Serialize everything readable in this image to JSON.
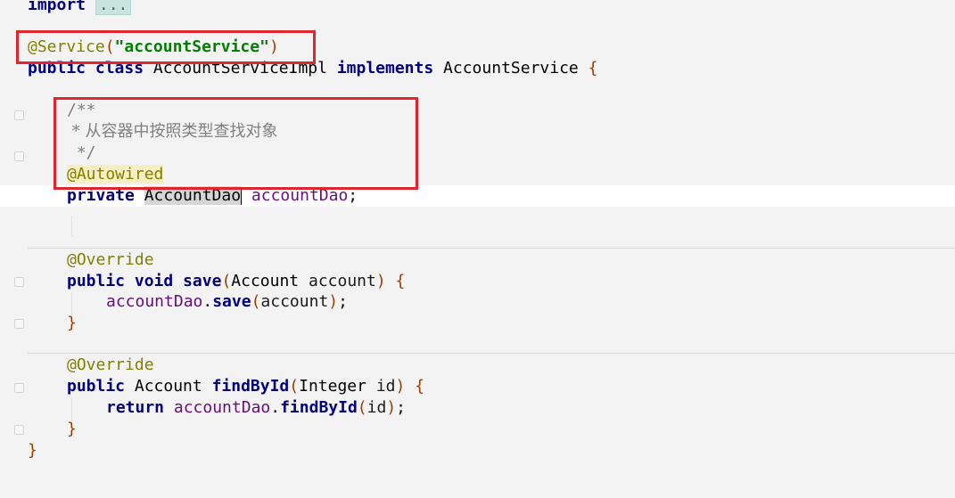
{
  "editor": {
    "lines": {
      "l0": {
        "kw": "import",
        "folded": "..."
      },
      "l2": {
        "ann": "@Service",
        "open": "(",
        "str": "\"accountService\"",
        "close": ")"
      },
      "l3": {
        "kw1": "public",
        "kw2": "class",
        "cls": "AccountServiceImpl",
        "kw3": "implements",
        "iface": "AccountService",
        "brace": "{"
      },
      "l5": {
        "text": "/**"
      },
      "l6": {
        "text": " * 从容器中按照类型查找对象"
      },
      "l7": {
        "text": " */"
      },
      "l8": {
        "ann": "@Autowired"
      },
      "l9": {
        "kw": "private",
        "type": "AccountDao",
        "field": "accountDao",
        "semi": ";"
      },
      "l12": {
        "ann": "@Override"
      },
      "l13": {
        "kw1": "public",
        "kw2": "void",
        "method": "save",
        "open": "(",
        "ptype": "Account",
        "pname": "account",
        "close": ")",
        "brace": "{"
      },
      "l14": {
        "obj": "accountDao",
        "dot": ".",
        "method": "save",
        "open": "(",
        "arg": "account",
        "close": ")",
        "semi": ";"
      },
      "l15": {
        "brace": "}"
      },
      "l17": {
        "ann": "@Override"
      },
      "l18": {
        "kw": "public",
        "rtype": "Account",
        "method": "findById",
        "open": "(",
        "ptype": "Integer",
        "pname": "id",
        "close": ")",
        "brace": "{"
      },
      "l19": {
        "kw": "return",
        "obj": "accountDao",
        "dot": ".",
        "method": "findById",
        "open": "(",
        "arg": "id",
        "close": ")",
        "semi": ";"
      },
      "l20": {
        "brace": "}"
      },
      "l21": {
        "brace": "}"
      }
    },
    "colors": {
      "highlight_box": "#e0252e",
      "background": "#f3f3f3",
      "caret_line": "#ffffff"
    }
  }
}
